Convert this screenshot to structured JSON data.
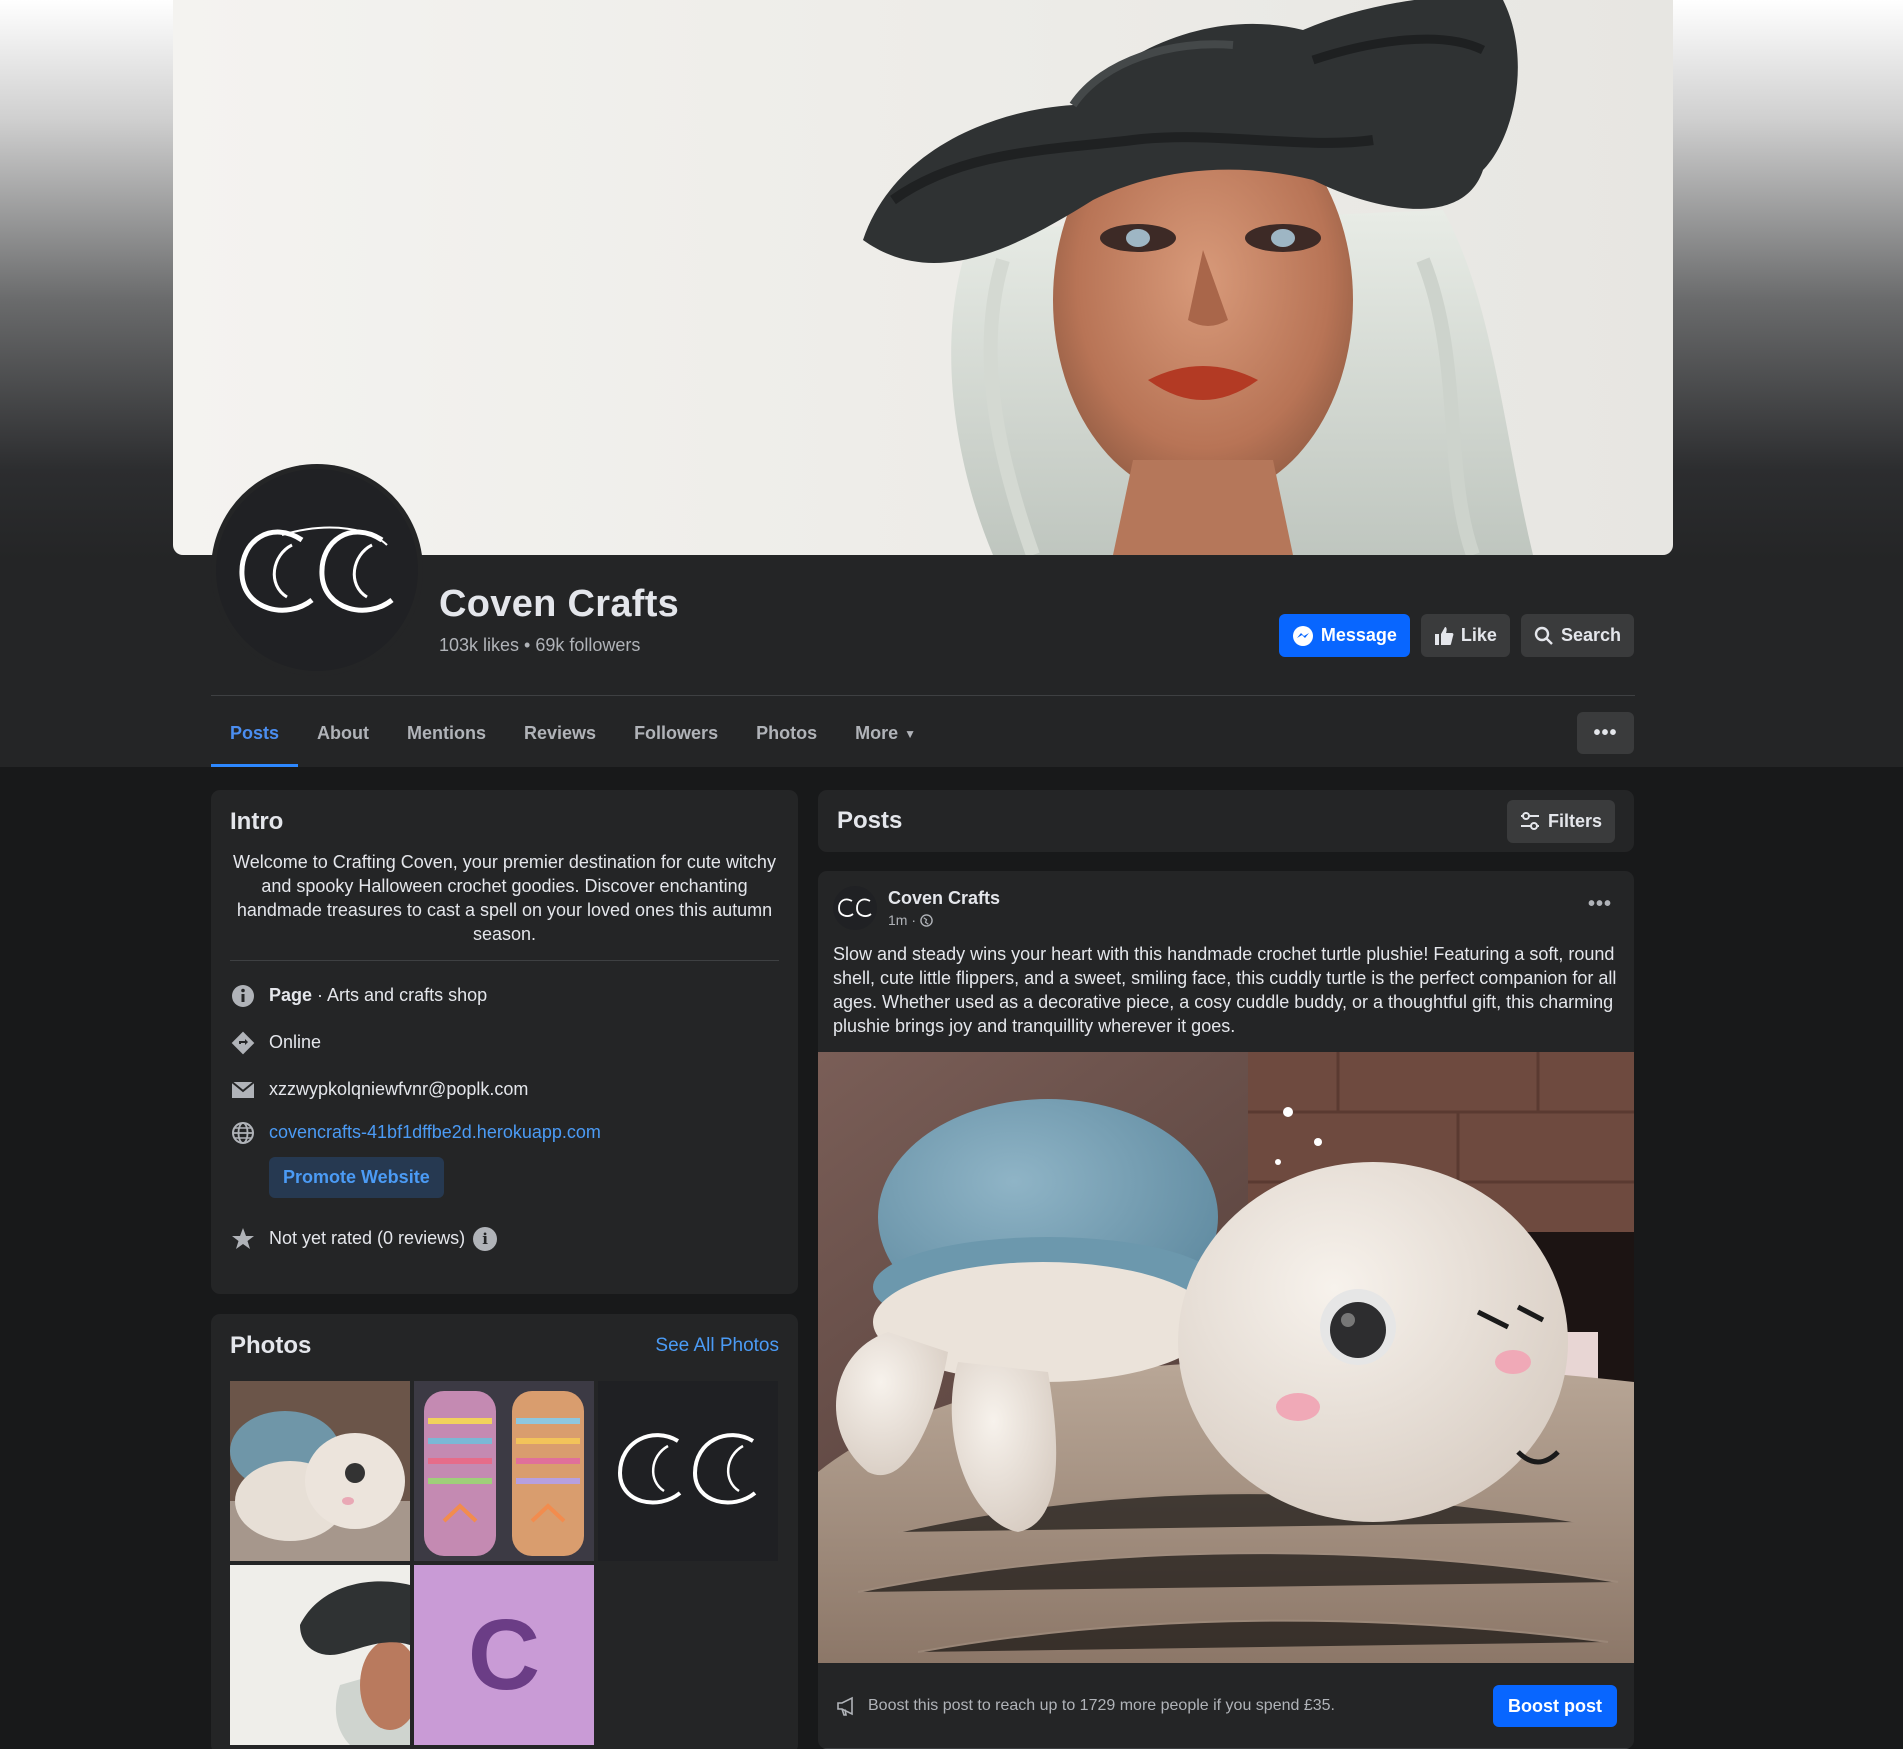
{
  "page": {
    "name": "Coven Crafts",
    "likes": "103k likes",
    "followers": "69k followers",
    "stats_separator": "•"
  },
  "actions": {
    "message": "Message",
    "like": "Like",
    "search": "Search"
  },
  "tabs": [
    {
      "label": "Posts",
      "active": true
    },
    {
      "label": "About"
    },
    {
      "label": "Mentions"
    },
    {
      "label": "Reviews"
    },
    {
      "label": "Followers"
    },
    {
      "label": "Photos"
    },
    {
      "label": "More"
    }
  ],
  "intro": {
    "title": "Intro",
    "description": "Welcome to Crafting Coven, your premier destination for cute witchy and spooky Halloween crochet goodies. Discover enchanting handmade treasures to cast a spell on your loved ones this autumn season.",
    "category_label": "Page",
    "category_value": " · Arts and crafts shop",
    "status": "Online",
    "email": "xzzwypkolqniewfvnr@poplk.com",
    "website": "covencrafts-41bf1dffbe2d.herokuapp.com",
    "promote_button": "Promote Website",
    "rating": "Not yet rated (0 reviews)"
  },
  "photos": {
    "title": "Photos",
    "see_all": "See All Photos",
    "tile_letter": "C"
  },
  "posts": {
    "title": "Posts",
    "filters": "Filters"
  },
  "post": {
    "author": "Coven Crafts",
    "time": "1m ·",
    "text": "Slow and steady wins your heart with this handmade crochet turtle plushie! Featuring a soft, round shell, cute little flippers, and a sweet, smiling face, this cuddly turtle is the perfect companion for all ages. Whether used as a decorative piece, a cosy cuddle buddy, or a thoughtful gift, this charming plushie brings joy and tranquillity wherever it goes.",
    "boost_text": "Boost this post to reach up to 1729 more people if you spend £35.",
    "boost_button": "Boost post"
  },
  "colors": {
    "accent": "#0866ff",
    "link": "#4b9bf5",
    "background": "#18191a",
    "card": "#242526"
  },
  "icons": [
    "messenger-icon",
    "thumbs-up-icon",
    "search-icon",
    "info-icon",
    "diamond-icon",
    "mail-icon",
    "globe-icon",
    "star-icon",
    "filters-icon",
    "globe-small-icon",
    "megaphone-icon",
    "more-dots-icon",
    "caret-down-icon"
  ]
}
